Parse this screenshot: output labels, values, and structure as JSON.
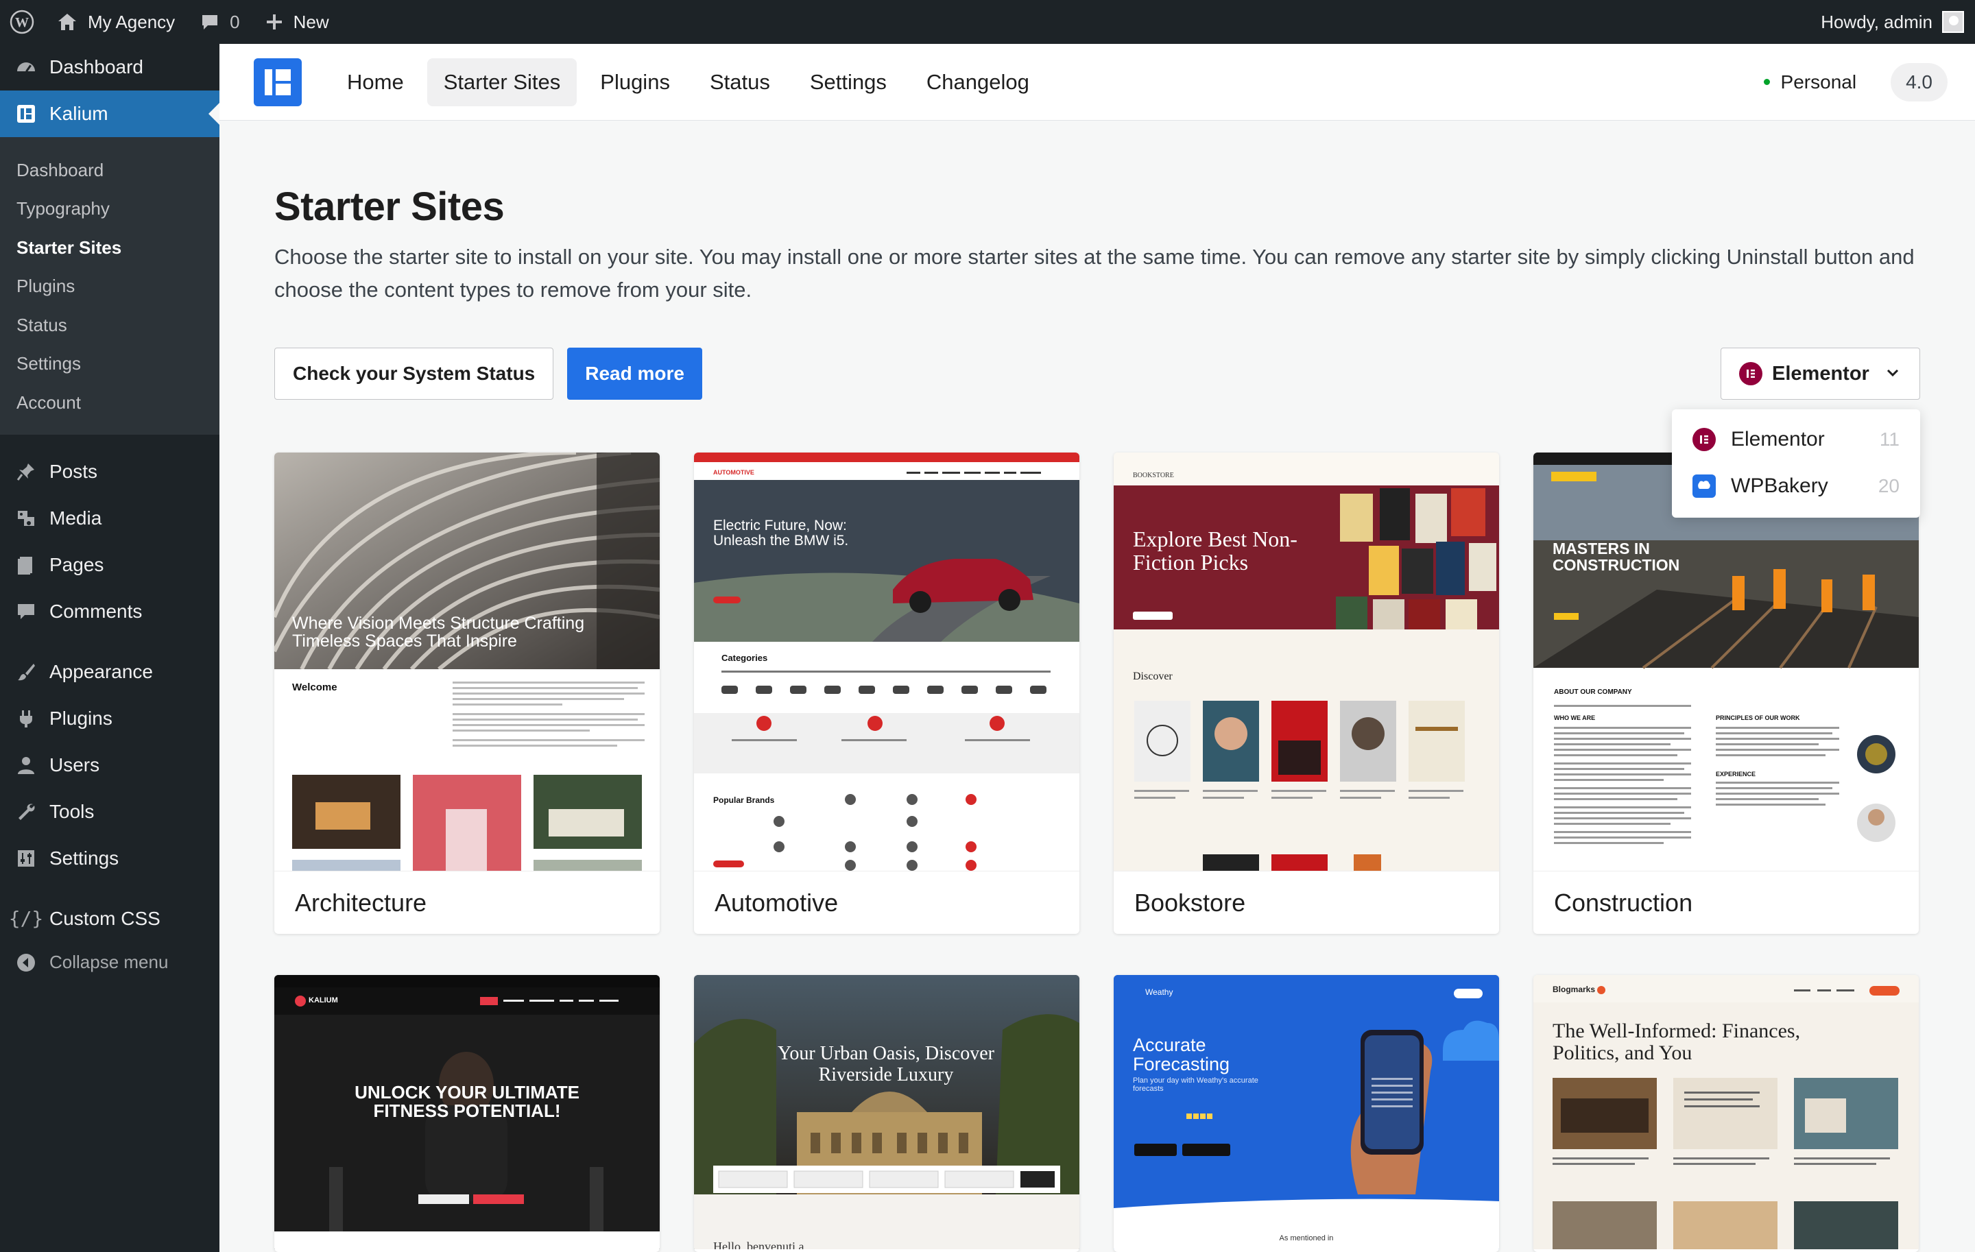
{
  "adminbar": {
    "site_name": "My Agency",
    "comments_count": "0",
    "new_label": "New",
    "howdy": "Howdy, admin"
  },
  "sidebar": {
    "dashboard": "Dashboard",
    "kalium": "Kalium",
    "submenu": [
      "Dashboard",
      "Typography",
      "Starter Sites",
      "Plugins",
      "Status",
      "Settings",
      "Account"
    ],
    "posts": "Posts",
    "media": "Media",
    "pages": "Pages",
    "comments": "Comments",
    "appearance": "Appearance",
    "plugins": "Plugins",
    "users": "Users",
    "tools": "Tools",
    "settings": "Settings",
    "custom_css": "Custom CSS",
    "collapse": "Collapse menu"
  },
  "kalium_nav": {
    "items": [
      "Home",
      "Starter Sites",
      "Plugins",
      "Status",
      "Settings",
      "Changelog"
    ],
    "license": "Personal",
    "version": "4.0"
  },
  "page": {
    "title": "Starter Sites",
    "description": "Choose the starter site to install on your site. You may install one or more starter sites at the same time. You can remove any starter site by simply clicking Uninstall button and choose the content types to remove from your site.",
    "check_status": "Check your System Status",
    "read_more": "Read more"
  },
  "builder": {
    "selected": "Elementor",
    "options": [
      {
        "label": "Elementor",
        "count": "11"
      },
      {
        "label": "WPBakery",
        "count": "20"
      }
    ]
  },
  "cards": [
    {
      "name": "Architecture"
    },
    {
      "name": "Automotive"
    },
    {
      "name": "Bookstore"
    },
    {
      "name": "Construction"
    },
    {
      "name": ""
    },
    {
      "name": ""
    },
    {
      "name": ""
    },
    {
      "name": ""
    }
  ],
  "previews": {
    "architecture": {
      "hero": "Where Vision Meets Structure Crafting Timeless Spaces That Inspire",
      "welcome": "Welcome"
    },
    "automotive": {
      "hero": "Electric Future, Now: Unleash the BMW i5.",
      "categories": "Categories",
      "brands": "Popular Brands"
    },
    "bookstore": {
      "logo": "BOOKSTORE",
      "hero": "Explore Best Non-Fiction Picks",
      "discover": "Discover"
    },
    "construction": {
      "hero": "MASTERS IN CONSTRUCTION",
      "about": "ABOUT OUR COMPANY",
      "who": "WHO WE ARE",
      "principles": "PRINCIPLES OF OUR WORK",
      "experience": "EXPERIENCE"
    },
    "fitness": {
      "logo": "KALIUM",
      "hero": "UNLOCK YOUR ULTIMATE FITNESS POTENTIAL!"
    },
    "hotel": {
      "hero": "Your Urban Oasis, Discover Riverside Luxury",
      "sub": "Hello, benvenuti a"
    },
    "weather": {
      "logo": "Weathy",
      "hero": "Accurate Forecasting",
      "sub": "Plan your day with Weathy's accurate forecasts",
      "mentioned": "As mentioned in"
    },
    "blog": {
      "logo": "Blogmarks",
      "hero": "The Well-Informed: Finances, Politics, and You"
    }
  },
  "colors": {
    "accent": "#2271e6",
    "wp_blue": "#2271b1",
    "admin_dark": "#1d2327",
    "elementor": "#92003b"
  }
}
